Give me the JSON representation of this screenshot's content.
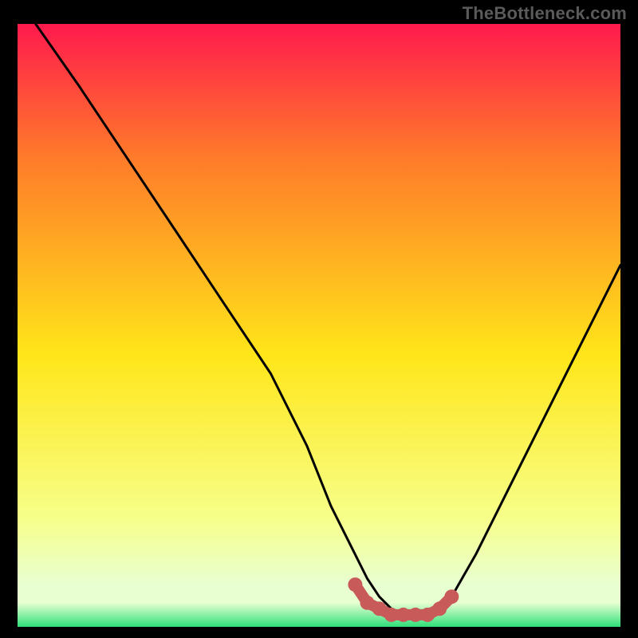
{
  "watermark": "TheBottleneck.com",
  "colors": {
    "gradient_top": "#ff1a4d",
    "gradient_upper_mid": "#ff7a2a",
    "gradient_mid": "#ffe619",
    "gradient_lower": "#f7ff8a",
    "gradient_band": "#e8ffd2",
    "gradient_bottom": "#2fe07a",
    "curve": "#000000",
    "marker": "#c85a5a",
    "frame": "#000000"
  },
  "chart_data": {
    "type": "line",
    "title": "",
    "xlabel": "",
    "ylabel": "",
    "xlim": [
      0,
      100
    ],
    "ylim": [
      0,
      100
    ],
    "series": [
      {
        "name": "bottleneck-curve",
        "x": [
          3,
          10,
          18,
          26,
          34,
          42,
          48,
          52,
          56,
          58,
          60,
          62,
          64,
          66,
          68,
          70,
          72,
          76,
          82,
          90,
          100
        ],
        "y": [
          100,
          90,
          78,
          66,
          54,
          42,
          30,
          20,
          12,
          8,
          5,
          3,
          2,
          2,
          2,
          3,
          5,
          12,
          24,
          40,
          60
        ]
      }
    ],
    "markers": {
      "name": "highlighted-range",
      "x": [
        56,
        58,
        60,
        62,
        64,
        66,
        68,
        70,
        72
      ],
      "y": [
        7,
        4,
        3,
        2,
        2,
        2,
        2,
        3,
        5
      ]
    },
    "gradient_bands_y": [
      0,
      4,
      8,
      38,
      62,
      82,
      100
    ]
  }
}
